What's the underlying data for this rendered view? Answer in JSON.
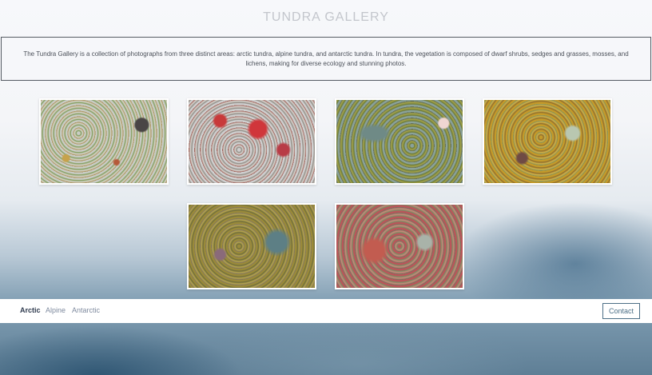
{
  "header": {
    "title": "TUNDRA GALLERY"
  },
  "intro": {
    "text": "The Tundra Gallery is a collection of photographs from three distinct areas: arctic tundra, alpine tundra, and antarctic tundra. In tundra, the vegetation is composed of dwarf shrubs, sedges and grasses, mosses, and lichens, making for diverse ecology and stunning photos."
  },
  "gallery": {
    "photos": [
      {
        "subject": "lichen and moss ground cover with dark rock"
      },
      {
        "subject": "red leaves among grey lichen"
      },
      {
        "subject": "green lichen with small pink mushroom"
      },
      {
        "subject": "golden moss and pale lichen"
      },
      {
        "subject": "mixed moss and blue-green lichen"
      },
      {
        "subject": "red-tinted moss and lichen"
      }
    ]
  },
  "nav": {
    "links": [
      {
        "label": "Arctic",
        "active": true
      },
      {
        "label": "Alpine",
        "active": false
      },
      {
        "label": "Antarctic",
        "active": false
      }
    ],
    "contact_label": "Contact"
  },
  "colors": {
    "accent": "#4c6f86",
    "nav_active": "#2e3a4e",
    "nav_inactive": "#7e8a9e",
    "title": "#c3c6cc",
    "border": "#555b63"
  }
}
